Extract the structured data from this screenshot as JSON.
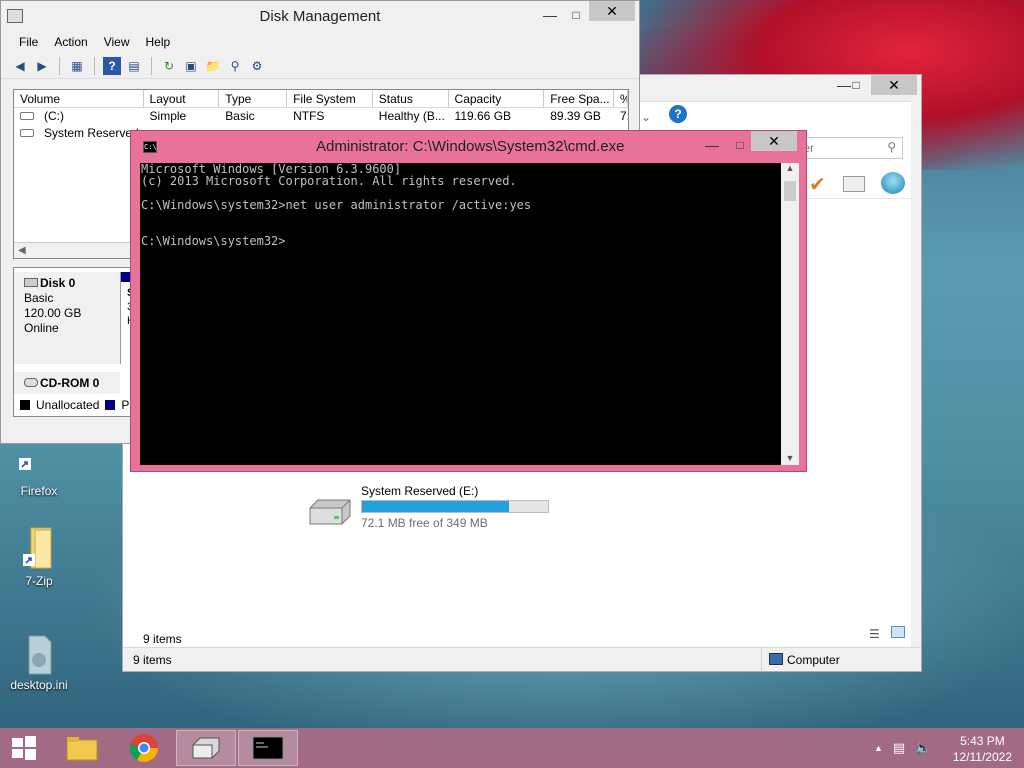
{
  "desktop": {
    "icons": [
      {
        "label": "Firefox"
      },
      {
        "label": "7-Zip"
      },
      {
        "label": "desktop.ini"
      }
    ]
  },
  "explorer": {
    "search_placeholder": "ter",
    "drive": {
      "name": "System Reserved (E:)",
      "free_text": "72.1 MB free of 349 MB",
      "used_fraction": 0.79
    },
    "items_count": "9 items",
    "status_items": "9 items",
    "status_location": "Computer"
  },
  "disk_management": {
    "title": "Disk Management",
    "menu": [
      "File",
      "Action",
      "View",
      "Help"
    ],
    "columns": [
      "Volume",
      "Layout",
      "Type",
      "File System",
      "Status",
      "Capacity",
      "Free Spa...",
      "%"
    ],
    "rows": [
      [
        "(C:)",
        "Simple",
        "Basic",
        "NTFS",
        "Healthy (B...",
        "119.66 GB",
        "89.39 GB",
        "7:"
      ],
      [
        "System Reserved (",
        "",
        "",
        "",
        "",
        "",
        "",
        ""
      ]
    ],
    "disks": [
      {
        "name": "Disk 0",
        "type": "Basic",
        "size": "120.00 GB",
        "state": "Online"
      },
      {
        "name": "CD-ROM 0"
      }
    ],
    "partial_partition": {
      "l1": "S",
      "l2": "3",
      "l3": "H"
    },
    "legend": [
      {
        "label": "Unallocated",
        "color": "#000000"
      },
      {
        "label": "Pr",
        "color": "#000080"
      }
    ]
  },
  "cmd": {
    "title": "Administrator: C:\\Windows\\System32\\cmd.exe",
    "lines": [
      "Microsoft Windows [Version 6.3.9600]",
      "(c) 2013 Microsoft Corporation. All rights reserved.",
      "",
      "C:\\Windows\\system32>net user administrator /active:yes",
      "",
      "",
      "C:\\Windows\\system32>"
    ]
  },
  "taskbar": {
    "time": "5:43 PM",
    "date": "12/11/2022"
  }
}
